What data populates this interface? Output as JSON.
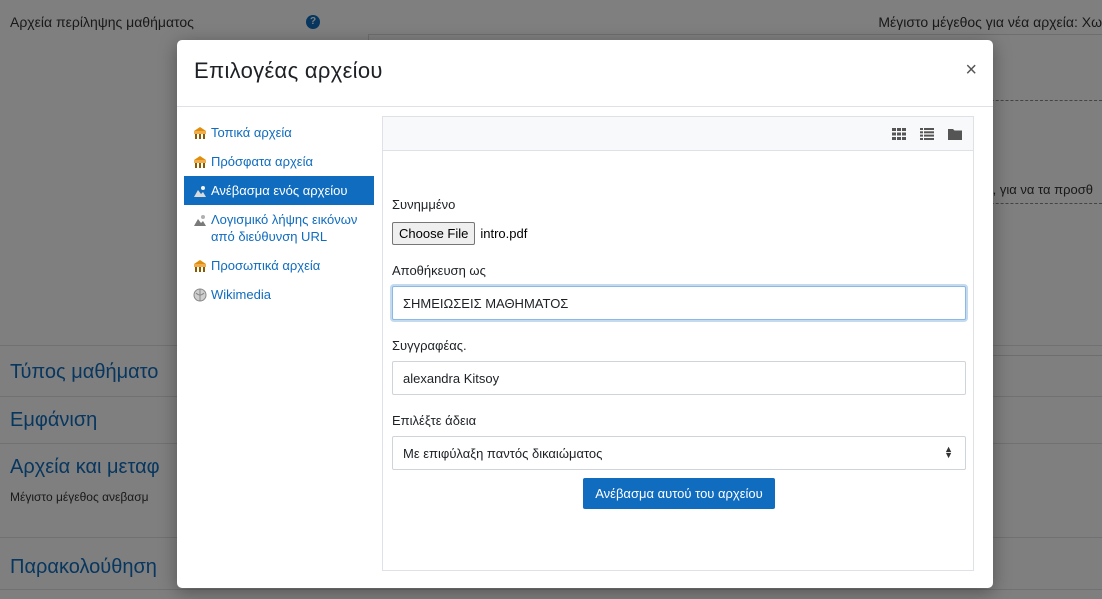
{
  "background": {
    "field_label": "Αρχεία περίληψης μαθήματος",
    "max_size_note": "Μέγιστο μέγεθος για νέα αρχεία: Χω",
    "drop_hint": "ων, για να τα προσθ",
    "sections": [
      "Τύπος μαθήματο",
      "Εμφάνιση",
      "Αρχεία και μεταφ",
      "Παρακολούθηση"
    ],
    "upload_size_note": "Μέγιστο μέγεθος ανεβασμ"
  },
  "modal": {
    "title": "Επιλογέας αρχείου",
    "close": "×"
  },
  "sidebar": {
    "items": [
      {
        "label": "Τοπικά αρχεία",
        "icon": "repository-icon"
      },
      {
        "label": "Πρόσφατα αρχεία",
        "icon": "repository-icon"
      },
      {
        "label": "Ανέβασμα ενός αρχείου",
        "icon": "upload-icon",
        "active": true
      },
      {
        "label": "Λογισμικό λήψης εικόνων από διεύθυνση URL",
        "icon": "url-downloader-icon"
      },
      {
        "label": "Προσωπικά αρχεία",
        "icon": "repository-icon"
      },
      {
        "label": "Wikimedia",
        "icon": "wikimedia-icon"
      }
    ]
  },
  "toolbar": {
    "views": [
      "icons-view-icon",
      "list-view-icon",
      "tree-view-icon"
    ]
  },
  "form": {
    "attachment_label": "Συνημμένο",
    "choose_file": "Choose File",
    "file_name": "intro.pdf",
    "save_as_label": "Αποθήκευση ως",
    "save_as_value": "ΣΗΜΕΙΩΣΕΙΣ ΜΑΘΗΜΑΤΟΣ",
    "author_label": "Συγγραφέας.",
    "author_value": "alexandra Kitsoy",
    "license_label": "Επιλέξτε άδεια",
    "license_value": "Με επιφύλαξη παντός δικαιώματος",
    "upload_button": "Ανέβασμα αυτού του αρχείου"
  },
  "colors": {
    "accent": "#0f6cbf",
    "overlay": "rgba(0,0,0,0.5)"
  }
}
